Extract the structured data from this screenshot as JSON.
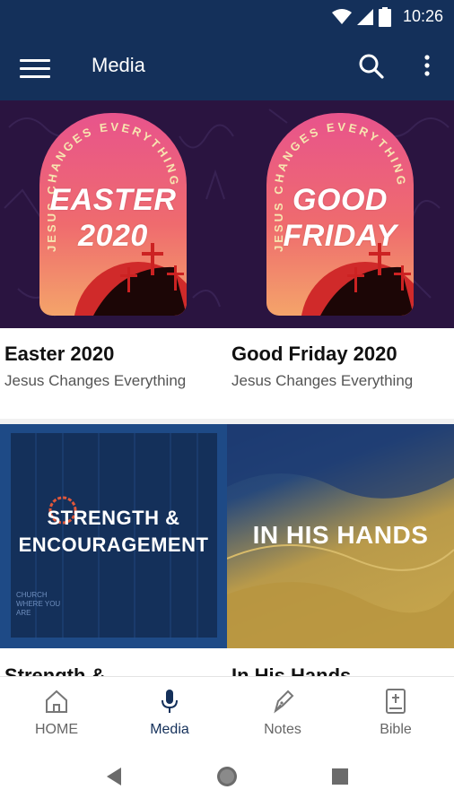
{
  "status_bar": {
    "time": "10:26"
  },
  "app_bar": {
    "title": "Media"
  },
  "media_items": [
    {
      "title": "Easter 2020",
      "subtitle": "Jesus Changes Everything",
      "art_text_line1": "EASTER",
      "art_text_line2": "2020",
      "art_arc": "JESUS CHANGES EVERYTHING"
    },
    {
      "title": "Good Friday 2020",
      "subtitle": "Jesus Changes Everything",
      "art_text_line1": "GOOD",
      "art_text_line2": "FRIDAY",
      "art_arc": "JESUS CHANGES EVERYTHING"
    },
    {
      "title": "Strength &",
      "art_text_line1": "STRENGTH &",
      "art_text_line2": "ENCOURAGEMENT",
      "art_small": "CHURCH WHERE YOU ARE"
    },
    {
      "title": "In His Hands",
      "art_text": "IN HIS HANDS"
    }
  ],
  "bottom_nav": [
    {
      "label": "HOME",
      "icon": "home-icon"
    },
    {
      "label": "Media",
      "icon": "microphone-icon",
      "active": true
    },
    {
      "label": "Notes",
      "icon": "pen-icon"
    },
    {
      "label": "Bible",
      "icon": "bible-icon"
    }
  ],
  "colors": {
    "app_bar": "#14305a",
    "active_nav": "#14305a",
    "row1_background": "#2a1440"
  }
}
